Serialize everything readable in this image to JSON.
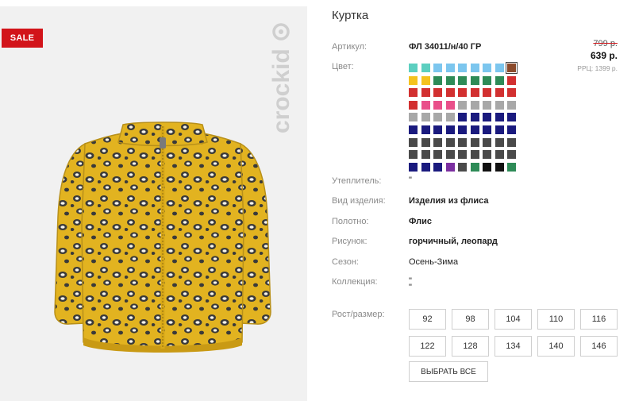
{
  "badge": {
    "sale": "SALE"
  },
  "brand": {
    "logo_text": "crockid"
  },
  "product": {
    "title": "Куртка",
    "article_label": "Артикул:",
    "article_value": "ФЛ 34011/н/40 ГР",
    "old_price": "799 р.",
    "price": "639 р.",
    "rrc": "РРЦ: 1399 р.",
    "color_label": "Цвет:"
  },
  "swatches": [
    "#5ccfc0",
    "#5ccfc0",
    "#7cc6ee",
    "#7cc6ee",
    "#7cc6ee",
    "#7cc6ee",
    "#7cc6ee",
    "#7cc6ee",
    "#8b4a2b",
    "#f4c21f",
    "#f4c21f",
    "#2e8b57",
    "#2e8b57",
    "#2e8b57",
    "#2e8b57",
    "#2e8b57",
    "#2e8b57",
    "#d23030",
    "#d23030",
    "#d23030",
    "#d23030",
    "#d23030",
    "#d23030",
    "#d23030",
    "#d23030",
    "#d23030",
    "#d23030",
    "#d23030",
    "#e94f8a",
    "#e94f8a",
    "#e94f8a",
    "#a8a8a8",
    "#a8a8a8",
    "#a8a8a8",
    "#a8a8a8",
    "#a8a8a8",
    "#a8a8a8",
    "#a8a8a8",
    "#a8a8a8",
    "#a8a8a8",
    "#1a1a7e",
    "#1a1a7e",
    "#1a1a7e",
    "#1a1a7e",
    "#1a1a7e",
    "#1a1a7e",
    "#1a1a7e",
    "#1a1a7e",
    "#1a1a7e",
    "#1a1a7e",
    "#1a1a7e",
    "#1a1a7e",
    "#1a1a7e",
    "#1a1a7e",
    "#4a4a4a",
    "#4a4a4a",
    "#4a4a4a",
    "#4a4a4a",
    "#4a4a4a",
    "#4a4a4a",
    "#4a4a4a",
    "#4a4a4a",
    "#4a4a4a",
    "#4a4a4a",
    "#4a4a4a",
    "#4a4a4a",
    "#4a4a4a",
    "#4a4a4a",
    "#4a4a4a",
    "#4a4a4a",
    "#4a4a4a",
    "#4a4a4a",
    "#1a1a7e",
    "#1a1a7e",
    "#1a1a7e",
    "#7b2fa0",
    "#4a4a4a",
    "#2e8b57",
    "#111111",
    "#111111",
    "#2e8b57"
  ],
  "selected_swatch": 8,
  "attributes": [
    {
      "label": "Утеплитель:",
      "value": "\"",
      "bold": false
    },
    {
      "label": "Вид изделия:",
      "value": "Изделия из флиса",
      "bold": true
    },
    {
      "label": "Полотно:",
      "value": "Флис",
      "bold": true
    },
    {
      "label": "Рисунок:",
      "value": "горчичный, леопард",
      "bold": true
    },
    {
      "label": "Сезон:",
      "value": "Осень-Зима",
      "bold": false
    },
    {
      "label": "Коллекция:",
      "value": "\"",
      "bold": false
    }
  ],
  "collection_extra": "\"",
  "sizes_label": "Рост/размер:",
  "sizes": [
    "92",
    "98",
    "104",
    "110",
    "116",
    "122",
    "128",
    "134",
    "140",
    "146"
  ],
  "select_all": "ВЫБРАТЬ ВСЕ"
}
